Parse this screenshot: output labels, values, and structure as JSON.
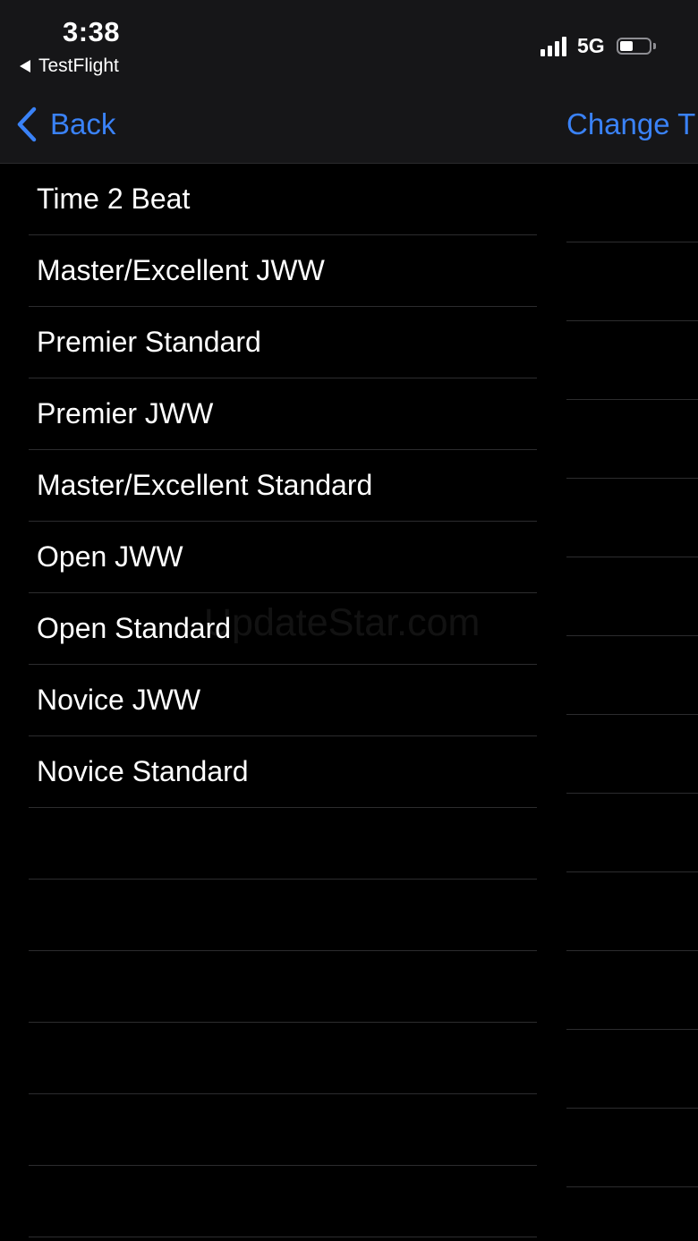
{
  "status_bar": {
    "time": "3:38",
    "return_app": "TestFlight",
    "network": "5G",
    "battery_level": 0.45
  },
  "nav": {
    "back_label": "Back",
    "right_label": "Change T"
  },
  "classes": {
    "items": [
      {
        "label": "Time 2 Beat"
      },
      {
        "label": "Master/Excellent JWW"
      },
      {
        "label": "Premier Standard"
      },
      {
        "label": "Premier JWW"
      },
      {
        "label": "Master/Excellent Standard"
      },
      {
        "label": "Open JWW"
      },
      {
        "label": "Open Standard"
      },
      {
        "label": "Novice JWW"
      },
      {
        "label": "Novice Standard"
      }
    ]
  },
  "watermark": "UpdateStar.com",
  "colors": {
    "accent": "#3a82f7",
    "background": "#000000",
    "bar_background": "#161618",
    "separator": "#2c2c2e"
  }
}
